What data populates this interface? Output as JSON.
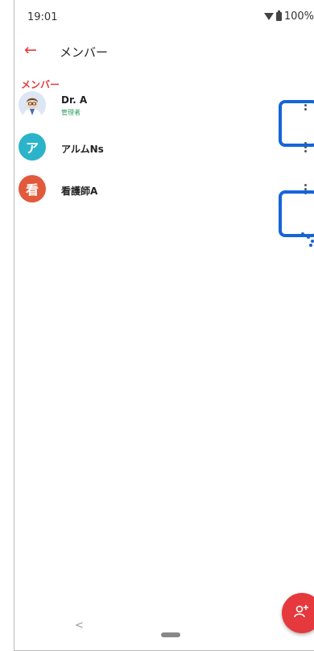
{
  "status_bar": {
    "time": "19:01",
    "battery": "100%"
  },
  "app_bar": {
    "title": "メンバー"
  },
  "section": {
    "label": "メンバー"
  },
  "members": [
    {
      "name": "Dr. A",
      "role": "管理者",
      "avatar_type": "photo"
    },
    {
      "name": "アルムNs",
      "avatar_letter": "ア",
      "avatar_color": "#2bb3c9"
    },
    {
      "name": "看護師A",
      "avatar_letter": "看",
      "avatar_color": "#e15a3b"
    }
  ],
  "colors": {
    "accent": "#e5393d",
    "highlight": "#1565d8",
    "role": "#2a9d61"
  },
  "icons": [
    "back-arrow-icon",
    "wifi-icon",
    "battery-icon",
    "more-vert-icon",
    "add-person-icon",
    "nav-back-icon",
    "nav-home-icon"
  ]
}
